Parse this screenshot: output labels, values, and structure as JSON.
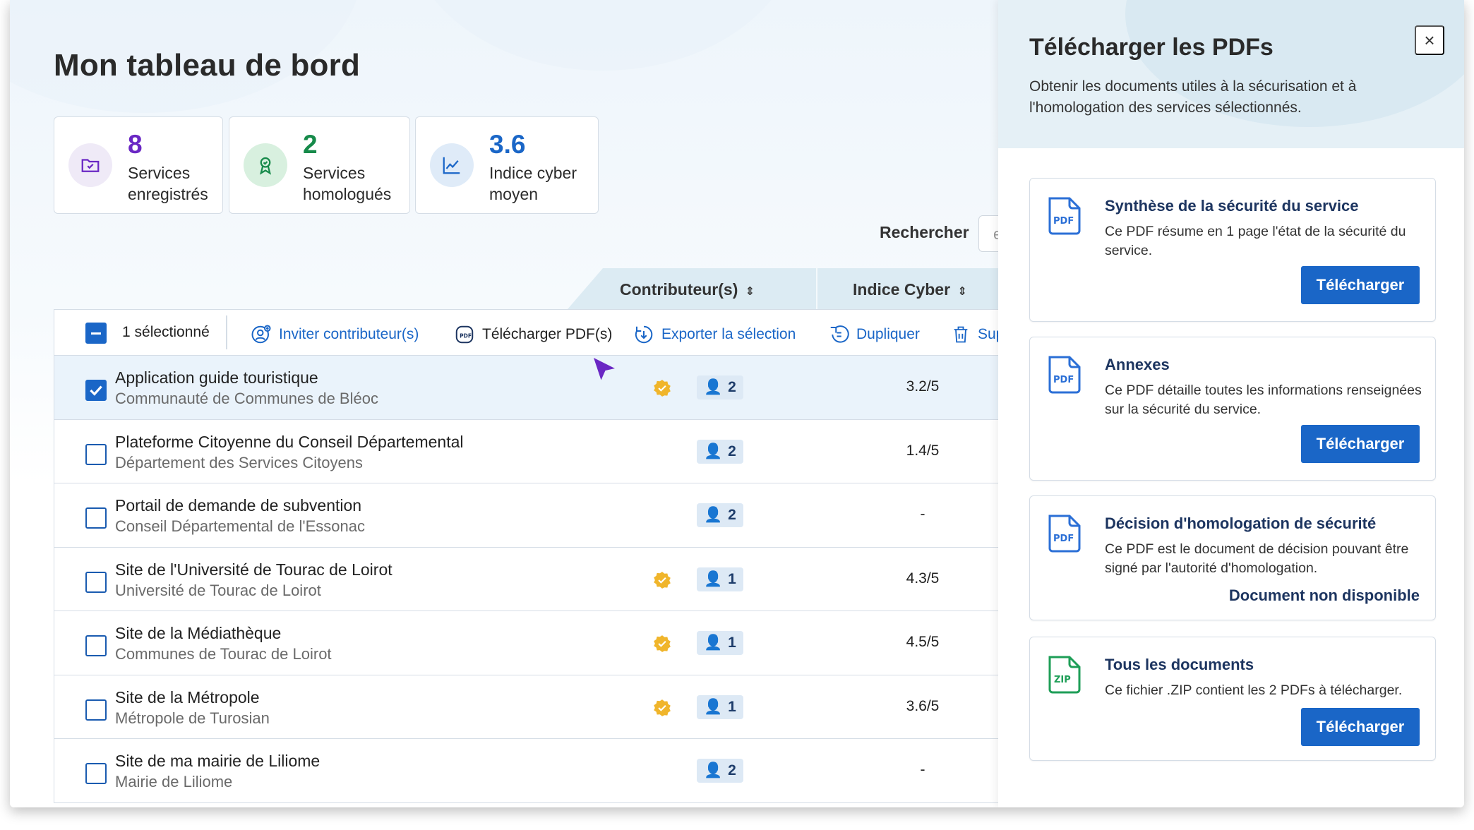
{
  "dashboard": {
    "title": "Mon tableau de bord",
    "stats": [
      {
        "value": "8",
        "label": "Services enregistrés",
        "color": "#6a27c4",
        "icon": "folder-check-icon"
      },
      {
        "value": "2",
        "label": "Services homologués",
        "color": "#168a4a",
        "icon": "award-icon"
      },
      {
        "value": "3.6",
        "label": "Indice cyber moyen",
        "color": "#1a66c7",
        "icon": "line-chart-icon"
      }
    ],
    "search_label": "Rechercher",
    "search_placeholder": "e",
    "columns": {
      "contributors": "Contributeur(s)",
      "cyber_index": "Indice Cyber"
    }
  },
  "toolbar": {
    "selected_count": "1 sélectionné",
    "invite": "Inviter contributeur(s)",
    "download_pdf": "Télécharger PDF(s)",
    "export": "Exporter la sélection",
    "duplicate": "Dupliquer",
    "delete": "Sup"
  },
  "services": [
    {
      "name": "Application guide touristique",
      "org": "Communauté de Communes de Bléoc",
      "homologated": true,
      "contributors": "2",
      "score": "3.2/5",
      "selected": true
    },
    {
      "name": "Plateforme Citoyenne du Conseil Départemental",
      "org": "Département des Services Citoyens",
      "homologated": false,
      "contributors": "2",
      "score": "1.4/5",
      "selected": false
    },
    {
      "name": "Portail de demande de subvention",
      "org": "Conseil Départemental de l'Essonac",
      "homologated": false,
      "contributors": "2",
      "score": "-",
      "selected": false
    },
    {
      "name": "Site de l'Université de Tourac de Loirot",
      "org": "Université de Tourac de Loirot",
      "homologated": true,
      "contributors": "1",
      "score": "4.3/5",
      "selected": false
    },
    {
      "name": "Site de la Médiathèque",
      "org": "Communes de Tourac de Loirot",
      "homologated": true,
      "contributors": "1",
      "score": "4.5/5",
      "selected": false
    },
    {
      "name": "Site de la Métropole",
      "org": "Métropole de Turosian",
      "homologated": true,
      "contributors": "1",
      "score": "3.6/5",
      "selected": false
    },
    {
      "name": "Site de ma mairie de Liliome",
      "org": "Mairie de Liliome",
      "homologated": false,
      "contributors": "2",
      "score": "-",
      "selected": false
    }
  ],
  "panel": {
    "title": "Télécharger les PDFs",
    "description": "Obtenir les documents utiles à la sécurisation et à l'homologation des services sélectionnés.",
    "close_label": "×",
    "documents": [
      {
        "type": "PDF",
        "title": "Synthèse de la sécurité du service",
        "desc": "Ce PDF résume en 1 page l'état de la sécurité du service.",
        "action": "Télécharger",
        "available": true
      },
      {
        "type": "PDF",
        "title": "Annexes",
        "desc": "Ce PDF détaille toutes les informations renseignées sur la sécurité du service.",
        "action": "Télécharger",
        "available": true
      },
      {
        "type": "PDF",
        "title": "Décision d'homologation de sécurité",
        "desc": "Ce PDF est le document de décision pouvant être signé par l'autorité d'homologation.",
        "action": "Document non disponible",
        "available": false
      },
      {
        "type": "ZIP",
        "title": "Tous les documents",
        "desc": "Ce fichier .ZIP contient les 2 PDFs à télécharger.",
        "action": "Télécharger",
        "available": true
      }
    ]
  },
  "colors": {
    "primary": "#1a66c7",
    "navy": "#1d3560",
    "badge_gold": "#f0b52b",
    "pdf_blue": "#2b6fd6",
    "zip_green": "#1e9e57"
  }
}
